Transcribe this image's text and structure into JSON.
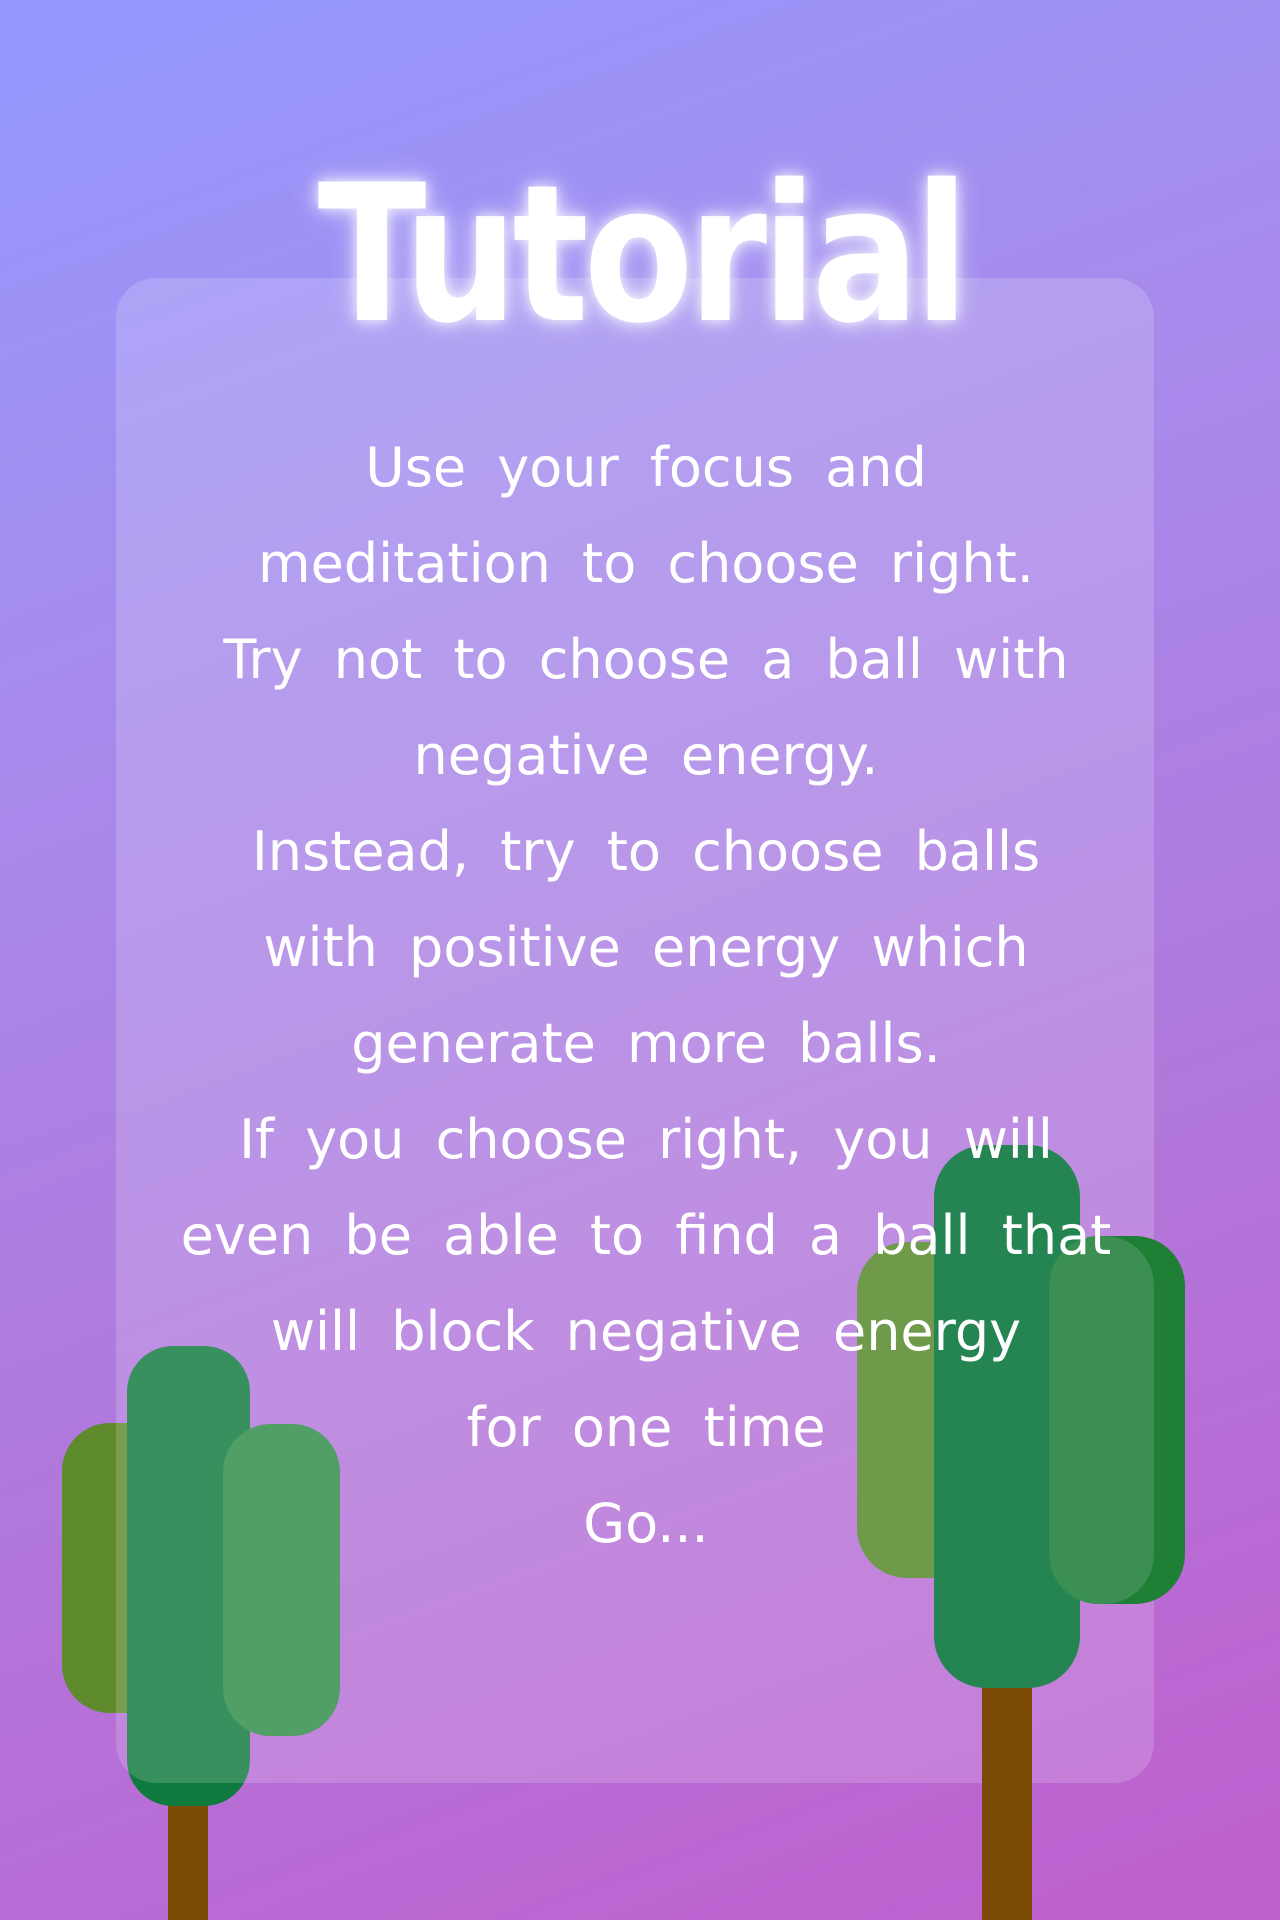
{
  "screen": {
    "title": "Tutorial",
    "background_colors": [
      "#9498fe",
      "#b277db",
      "#bf5ecd"
    ]
  },
  "tutorial": {
    "lines": [
      "Use your focus and",
      "meditation to choose right.",
      "Try not to choose a ball with",
      "negative energy.",
      "Instead, try to choose balls",
      "with positive energy which",
      "generate more balls.",
      "If you choose right, you will",
      "even be able to find a ball that",
      "will block negative energy",
      "for one time",
      "Go..."
    ]
  },
  "decor": {
    "tree_colors": [
      "#0f7a3d",
      "#2e8b47",
      "#5e8b2b",
      "#248553",
      "#6f9a49"
    ],
    "trunk_color": "#7b4a05"
  }
}
